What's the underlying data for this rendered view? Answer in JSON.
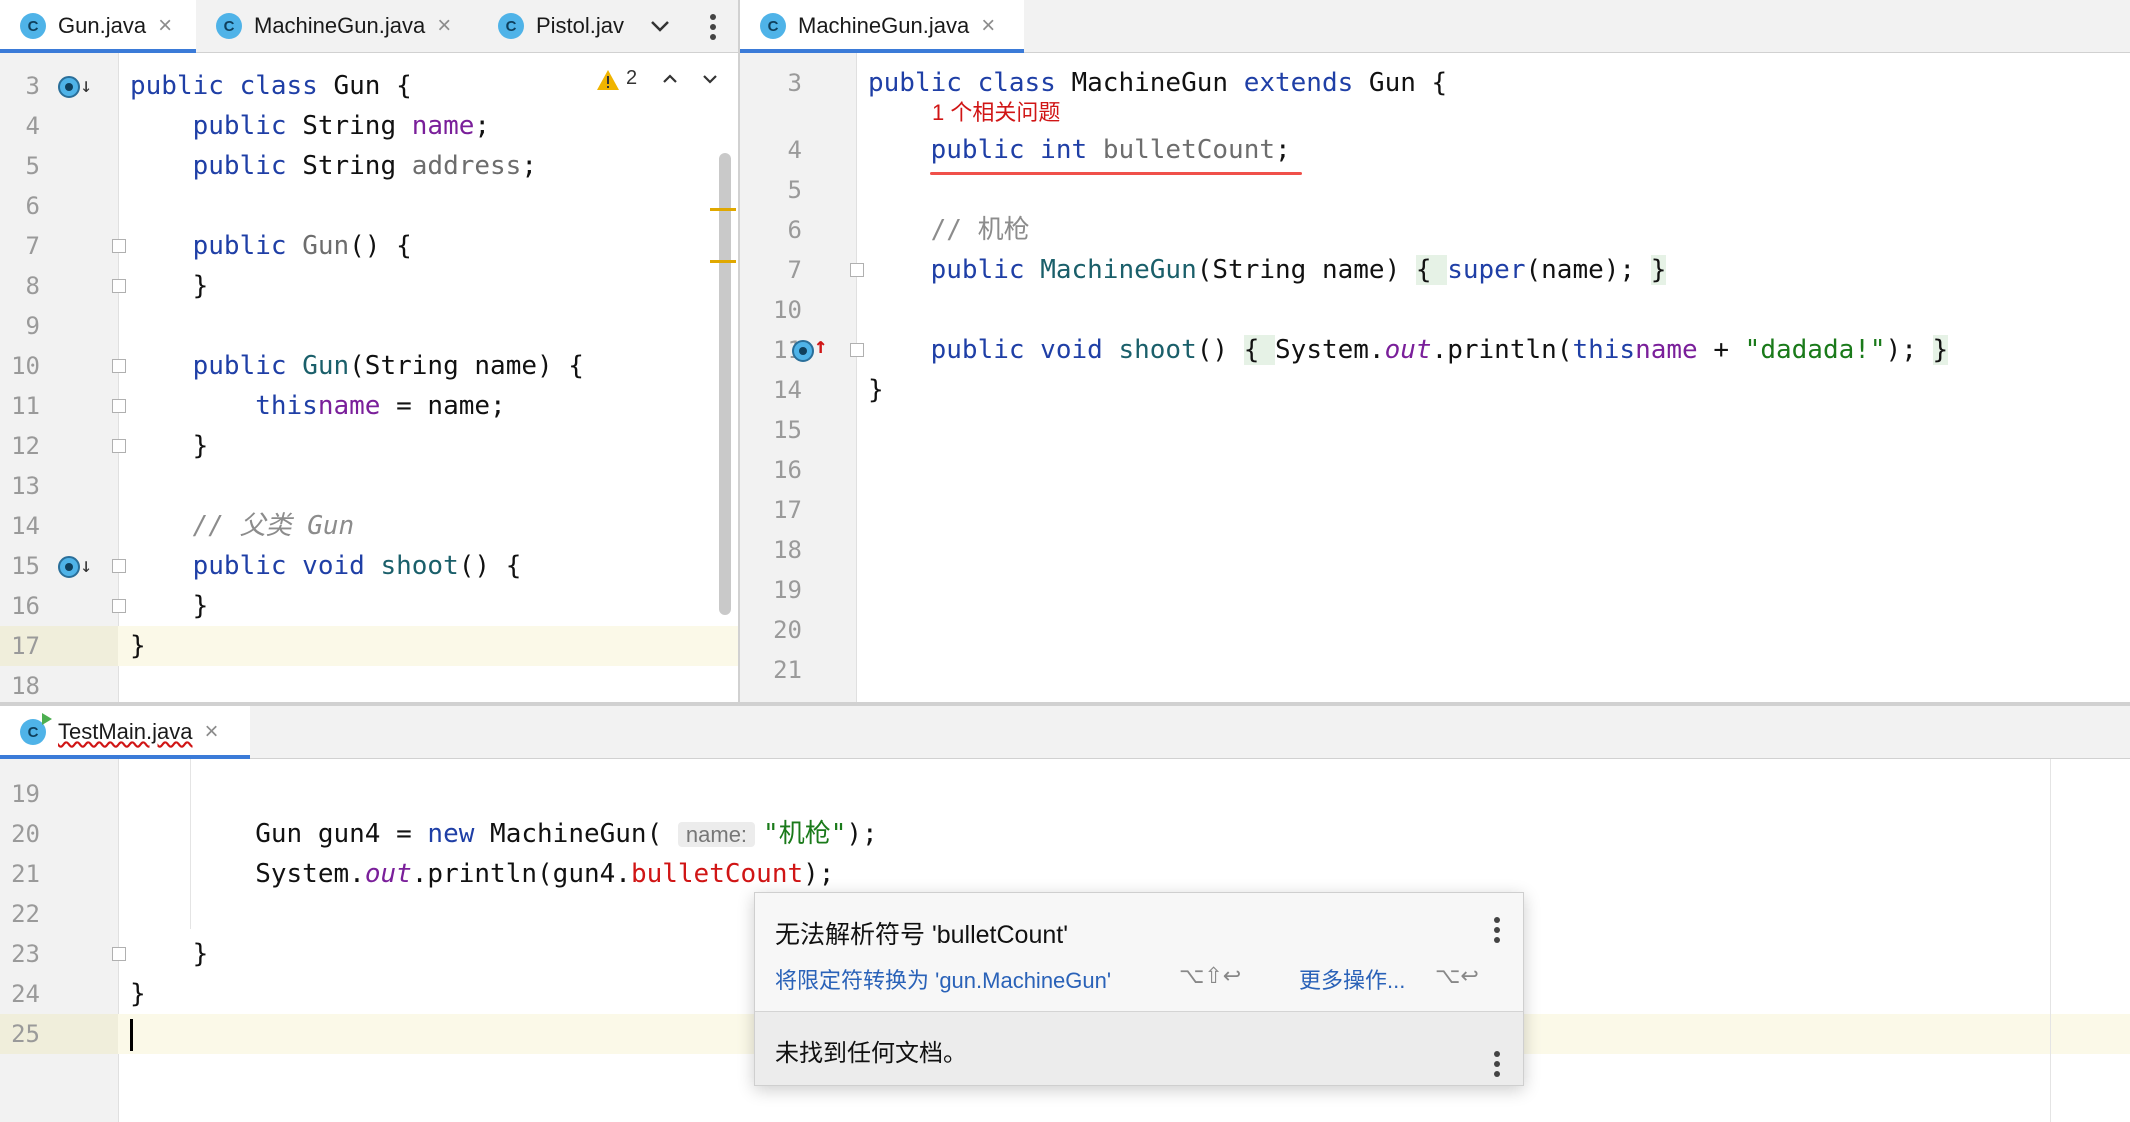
{
  "left_tabs": [
    {
      "label": "Gun.java",
      "active": true
    },
    {
      "label": "MachineGun.java",
      "active": false
    },
    {
      "label": "Pistol.jav",
      "active": false
    }
  ],
  "right_tabs": [
    {
      "label": "MachineGun.java",
      "active": true
    }
  ],
  "bottom_tabs": [
    {
      "label": "TestMain.java",
      "active": true
    }
  ],
  "tab_icon_letter": "C",
  "warning": {
    "count": "2"
  },
  "gun_pane": {
    "lines": [
      {
        "n": "3"
      },
      {
        "n": "4"
      },
      {
        "n": "5"
      },
      {
        "n": "6"
      },
      {
        "n": "7"
      },
      {
        "n": "8"
      },
      {
        "n": "9"
      },
      {
        "n": "10"
      },
      {
        "n": "11"
      },
      {
        "n": "12"
      },
      {
        "n": "13"
      },
      {
        "n": "14"
      },
      {
        "n": "15"
      },
      {
        "n": "16"
      },
      {
        "n": "17"
      },
      {
        "n": "18"
      }
    ],
    "code": {
      "l3a": "public class ",
      "l3b": "Gun {",
      "l4a": "    public ",
      "l4b": "String ",
      "l4c": "name",
      ";": ";",
      "l5a": "    public ",
      "l5b": "String ",
      "l5c": "address",
      "l7a": "    public ",
      "l7b": "Gun",
      "l7c": "() {",
      "l8": "    }",
      "l10a": "    public ",
      "l10b": "Gun",
      "l10c": "(String name) {",
      "l11a": "        this",
      ".": ".",
      "l11b": "name",
      "l11c": " = name;",
      "l12": "    }",
      "l14": "    // 父类 Gun",
      "l15a": "    public void ",
      "l15b": "shoot",
      "l15c": "() {",
      "l16": "    }",
      "l17": "}"
    }
  },
  "mg_pane": {
    "lines": [
      {
        "n": "3"
      },
      {
        "n": "4"
      },
      {
        "n": "5"
      },
      {
        "n": "6"
      },
      {
        "n": "7"
      },
      {
        "n": "10"
      },
      {
        "n": "11"
      },
      {
        "n": "14"
      },
      {
        "n": "15"
      },
      {
        "n": "16"
      },
      {
        "n": "17"
      },
      {
        "n": "18"
      },
      {
        "n": "19"
      },
      {
        "n": "20"
      },
      {
        "n": "21"
      }
    ],
    "problem_hint": "1 个相关问题",
    "code": {
      "l3a": "public class ",
      "l3b": "MachineGun ",
      "l3c": "extends ",
      "l3d": "Gun {",
      "l4a": "    public int ",
      "l4b": "bulletCount",
      "l4c": ";",
      "l6": "    // 机枪",
      "l7a": "    public ",
      "l7b": "MachineGun",
      "l7c": "(String name) ",
      "l7d": "{ ",
      "l7e": "super",
      "l7f": "(name); ",
      "l7g": "}",
      "l11a": "    public void ",
      "l11b": "shoot",
      "l11c": "() ",
      "l11d": "{ ",
      "l11e": "System.",
      "l11f": "out",
      "l11g": ".println(",
      "l11h": "this",
      ".": ".",
      "l11i": "name",
      " + ": " + ",
      "l11j": "\"dadada!\"",
      "l11k": "); ",
      "l11l": "}",
      "l14": "}"
    }
  },
  "test_pane": {
    "lines": [
      {
        "n": "19"
      },
      {
        "n": "20"
      },
      {
        "n": "21"
      },
      {
        "n": "22"
      },
      {
        "n": "23"
      },
      {
        "n": "24"
      },
      {
        "n": "25"
      }
    ],
    "code": {
      "l20a": "        Gun gun4 = ",
      "l20b": "new ",
      "l20c": "MachineGun( ",
      "l20hint": "name:",
      "l20d": "\"机枪\"",
      "l20e": ");",
      "l21a": "        System.",
      "l21b": "out",
      "l21c": ".println(gun4.",
      "l21d": "bulletCount",
      "l21e": ");",
      "l23": "    }",
      "l24": "}"
    }
  },
  "popup": {
    "title": "无法解析符号 'bulletCount'",
    "action": "将限定符转换为 'gun.MachineGun'",
    "action_shortcut": "⌥⇧↩",
    "more": "更多操作...",
    "more_shortcut": "⌥↩",
    "doc": "未找到任何文档。"
  }
}
